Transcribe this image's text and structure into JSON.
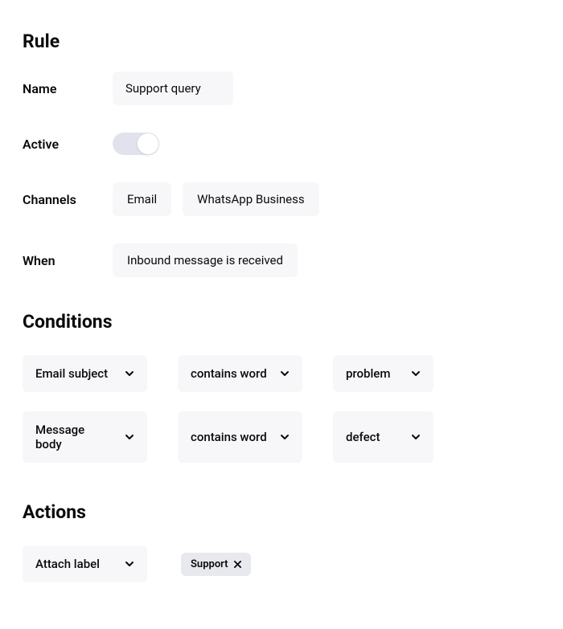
{
  "rule": {
    "heading": "Rule",
    "name_label": "Name",
    "name_value": "Support query",
    "active_label": "Active",
    "active_state": true,
    "channels_label": "Channels",
    "channels": [
      "Email",
      "WhatsApp Business"
    ],
    "when_label": "When",
    "when_value": "Inbound message is received"
  },
  "conditions": {
    "heading": "Conditions",
    "rows": [
      {
        "field": "Email subject",
        "operator": "contains word",
        "value": "problem"
      },
      {
        "field": "Message body",
        "operator": "contains word",
        "value": "defect"
      }
    ]
  },
  "actions": {
    "heading": "Actions",
    "rows": [
      {
        "action": "Attach label",
        "label": "Support"
      }
    ]
  }
}
